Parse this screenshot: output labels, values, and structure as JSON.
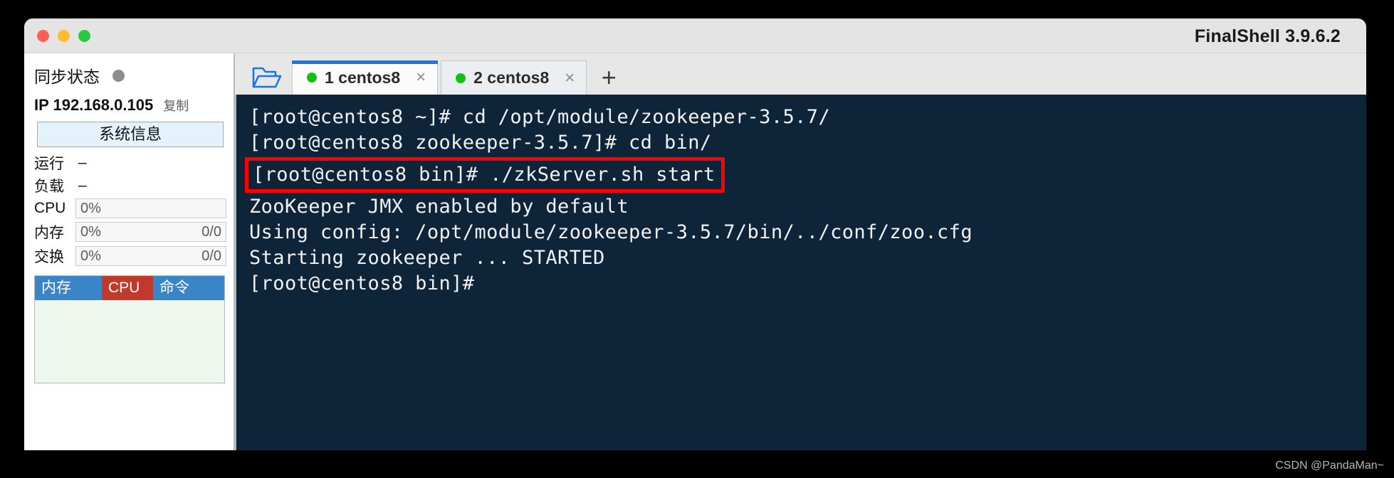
{
  "window": {
    "title": "FinalShell 3.9.6.2",
    "traffic_lights": [
      {
        "name": "close",
        "color": "#ff5f57"
      },
      {
        "name": "minimize",
        "color": "#febc2e"
      },
      {
        "name": "maximize",
        "color": "#28c840"
      }
    ]
  },
  "sidebar": {
    "sync": {
      "label": "同步状态",
      "status_color": "#8c8c8c"
    },
    "ip": {
      "text": "IP 192.168.0.105",
      "copy_label": "复制"
    },
    "system_info_button": "系统信息",
    "stats": [
      {
        "key": "运行",
        "value": "–",
        "type": "plain"
      },
      {
        "key": "负载",
        "value": "–",
        "type": "plain"
      }
    ],
    "meters": [
      {
        "key": "CPU",
        "percent": "0%",
        "fraction": ""
      },
      {
        "key": "内存",
        "percent": "0%",
        "fraction": "0/0"
      },
      {
        "key": "交换",
        "percent": "0%",
        "fraction": "0/0"
      }
    ],
    "process_table": {
      "columns": [
        {
          "label": "内存",
          "color": "#3a84c8"
        },
        {
          "label": "CPU",
          "color": "#c0392b"
        },
        {
          "label": "命令",
          "color": "#3a84c8"
        }
      ],
      "rows": []
    }
  },
  "tabbar": {
    "folder_icon": "folder-open-icon",
    "add_label": "+",
    "close_glyph": "×",
    "tabs": [
      {
        "label": "1  centos8",
        "active": true,
        "status_color": "#12c112"
      },
      {
        "label": "2  centos8",
        "active": false,
        "status_color": "#12c112"
      }
    ]
  },
  "terminal": {
    "background": "#0e2439",
    "foreground": "#f2f2f2",
    "highlight_color": "#ff0000",
    "lines": [
      {
        "text": "[root@centos8 ~]# cd /opt/module/zookeeper-3.5.7/",
        "boxed": false
      },
      {
        "text": "[root@centos8 zookeeper-3.5.7]# cd bin/",
        "boxed": false
      },
      {
        "text": "[root@centos8 bin]# ./zkServer.sh start",
        "boxed": true
      },
      {
        "text": "ZooKeeper JMX enabled by default",
        "boxed": false
      },
      {
        "text": "Using config: /opt/module/zookeeper-3.5.7/bin/../conf/zoo.cfg",
        "boxed": false
      },
      {
        "text": "Starting zookeeper ... STARTED",
        "boxed": false
      },
      {
        "text": "[root@centos8 bin]#",
        "boxed": false
      }
    ]
  },
  "watermark": "CSDN @PandaMan~"
}
